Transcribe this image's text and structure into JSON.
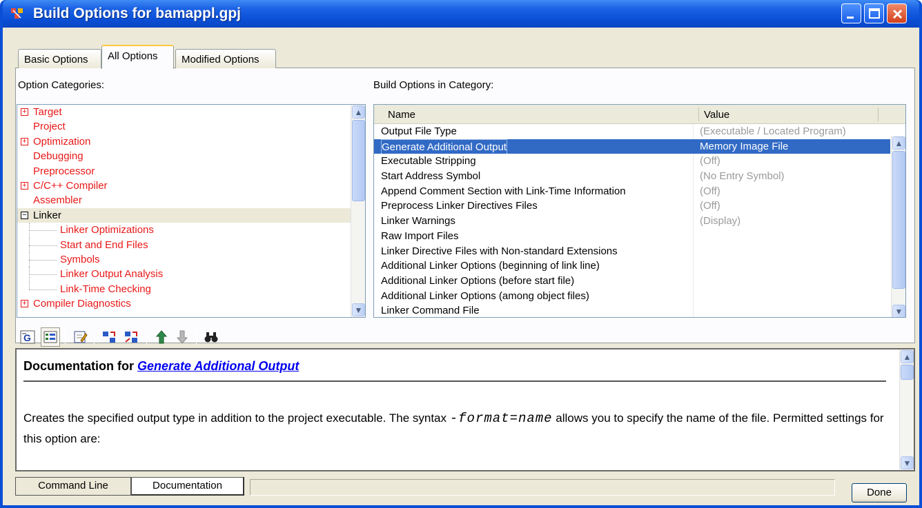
{
  "window": {
    "title": "Build Options for bamappl.gpj"
  },
  "tabs": [
    {
      "label": "Basic Options"
    },
    {
      "label": "All Options"
    },
    {
      "label": "Modified Options"
    }
  ],
  "left_panel": {
    "label": "Option Categories:",
    "items": [
      {
        "label": "Target"
      },
      {
        "label": "Project"
      },
      {
        "label": "Optimization"
      },
      {
        "label": "Debugging"
      },
      {
        "label": "Preprocessor"
      },
      {
        "label": "C/C++ Compiler"
      },
      {
        "label": "Assembler"
      },
      {
        "label": "Linker"
      },
      {
        "label": "Linker Optimizations"
      },
      {
        "label": "Start and End Files"
      },
      {
        "label": "Symbols"
      },
      {
        "label": "Linker Output Analysis"
      },
      {
        "label": "Link-Time Checking"
      },
      {
        "label": "Compiler Diagnostics"
      }
    ]
  },
  "right_panel": {
    "label": "Build Options in Category:",
    "columns": {
      "name": "Name",
      "value": "Value"
    },
    "rows": [
      {
        "name": "Output File Type",
        "value": "(Executable / Located Program)"
      },
      {
        "name": "Generate Additional Output",
        "value": "Memory Image File"
      },
      {
        "name": "Executable Stripping",
        "value": "(Off)"
      },
      {
        "name": "Start Address Symbol",
        "value": "(No Entry Symbol)"
      },
      {
        "name": "Append Comment Section with Link-Time Information",
        "value": "(Off)"
      },
      {
        "name": "Preprocess Linker Directives Files",
        "value": "(Off)"
      },
      {
        "name": "Linker Warnings",
        "value": "(Display)"
      },
      {
        "name": "Raw Import Files",
        "value": ""
      },
      {
        "name": "Linker Directive Files with Non-standard Extensions",
        "value": ""
      },
      {
        "name": "Additional Linker Options (beginning of link line)",
        "value": ""
      },
      {
        "name": "Additional Linker Options (before start file)",
        "value": ""
      },
      {
        "name": "Additional Linker Options (among object files)",
        "value": ""
      },
      {
        "name": "Linker Command File",
        "value": ""
      }
    ]
  },
  "documentation": {
    "heading_prefix": "Documentation for ",
    "heading_link": "Generate Additional Output",
    "text_before": "Creates the specified output type in addition to the project executable. The syntax ",
    "code": "-format=name",
    "text_after": " allows you to specify the name of the file. Permitted settings for this option are:"
  },
  "bottom": {
    "tab_command_line": "Command Line",
    "tab_documentation": "Documentation",
    "done_label": "Done"
  },
  "colors": {
    "title_bar": "#0a4fd6",
    "category_red": "#e81818",
    "selection_blue": "#316ac5",
    "link_blue": "#0000ee"
  },
  "icons": [
    "app-icon",
    "show-gui-names-icon",
    "show-categories-icon",
    "edit-icon",
    "expand-icon",
    "collapse-icon",
    "move-up-icon",
    "move-down-icon",
    "find-icon"
  ]
}
